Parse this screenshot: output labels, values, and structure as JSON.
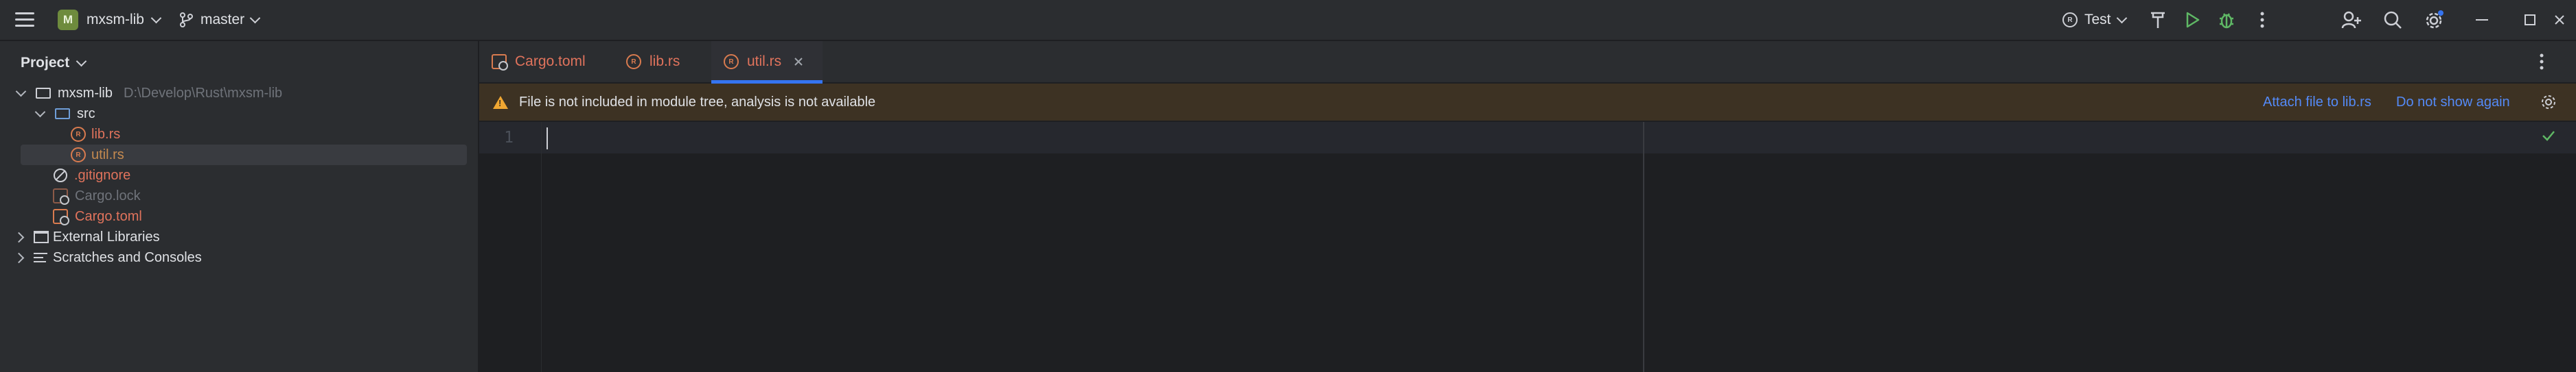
{
  "titlebar": {
    "project_badge": "M",
    "project_name": "mxsm-lib",
    "branch": "master",
    "run_config": "Test"
  },
  "project_panel": {
    "title": "Project",
    "tree": [
      {
        "label": "mxsm-lib",
        "path": "D:\\Develop\\Rust\\mxsm-lib",
        "type": "folder",
        "color": "#dfe1e5"
      },
      {
        "label": "src",
        "type": "folder-src",
        "color": "#dfe1e5"
      },
      {
        "label": "lib.rs",
        "type": "rust",
        "color": "#e0735c"
      },
      {
        "label": "util.rs",
        "type": "rust",
        "color": "#c58a4f"
      },
      {
        "label": ".gitignore",
        "type": "ignore",
        "color": "#e0735c"
      },
      {
        "label": "Cargo.lock",
        "type": "cargo",
        "color": "#6f737a"
      },
      {
        "label": "Cargo.toml",
        "type": "cargo",
        "color": "#e0735c"
      },
      {
        "label": "External Libraries",
        "type": "library",
        "color": "#dfe1e5"
      },
      {
        "label": "Scratches and Consoles",
        "type": "scratches",
        "color": "#dfe1e5"
      }
    ]
  },
  "tabs": [
    {
      "label": "Cargo.toml",
      "color": "#e0735c",
      "icon": "cargo-icon"
    },
    {
      "label": "lib.rs",
      "color": "#e0735c",
      "icon": "rust-icon"
    },
    {
      "label": "util.rs",
      "color": "#e0735c",
      "icon": "rust-icon",
      "active": true
    }
  ],
  "banner": {
    "message": "File is not included in module tree, analysis is not available",
    "attach_link": "Attach file to lib.rs",
    "dismiss_link": "Do not show again"
  },
  "editor": {
    "line_numbers": [
      "1"
    ]
  },
  "colors": {
    "accent": "#3574f0",
    "warning": "#f0a732",
    "ok": "#5fb865"
  }
}
